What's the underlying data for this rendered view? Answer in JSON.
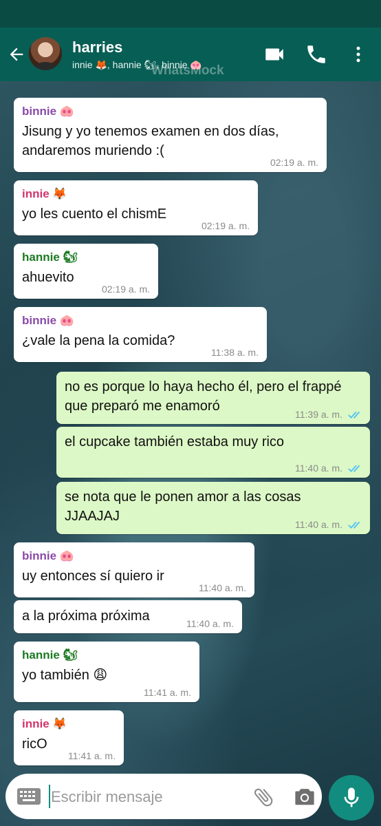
{
  "header": {
    "title": "harries",
    "subtitle": "innie 🦊, hannie 🐿, binnie 🐽",
    "watermark": "WhatsMock"
  },
  "messages": [
    {
      "sender": "binnie",
      "sender_label": "binnie 🐽",
      "text": "Jisung y yo tenemos examen en dos días, andaremos muriendo :(",
      "time": "02:19 a. m.",
      "direction": "in"
    },
    {
      "sender": "innie",
      "sender_label": "innie 🦊",
      "text": "yo les cuento el chismE",
      "time": "02:19 a. m.",
      "direction": "in"
    },
    {
      "sender": "hannie",
      "sender_label": "hannie 🐿",
      "text": "ahuevito",
      "time": "02:19 a. m.",
      "direction": "in"
    },
    {
      "sender": "binnie",
      "sender_label": "binnie 🐽",
      "text": "¿vale la pena la comida?",
      "time": "11:38 a. m.",
      "direction": "in"
    },
    {
      "sender": "me",
      "text": "no es porque lo haya hecho él, pero el frappé que preparó me enamoró",
      "time": "11:39 a. m.",
      "direction": "out"
    },
    {
      "sender": "me",
      "text": "el cupcake también estaba muy rico",
      "time": "11:40 a. m.",
      "direction": "out"
    },
    {
      "sender": "me",
      "text": "se nota que le ponen amor a las cosas JJAAJAJ",
      "time": "11:40 a. m.",
      "direction": "out"
    },
    {
      "sender": "binnie",
      "sender_label": "binnie 🐽",
      "text": "uy entonces sí quiero ir",
      "time": "11:40 a. m.",
      "direction": "in"
    },
    {
      "sender": "binnie",
      "text": "a la próxima próxima",
      "time": "11:40 a. m.",
      "direction": "in"
    },
    {
      "sender": "hannie",
      "sender_label": "hannie 🐿",
      "text": "yo también 😩",
      "time": "11:41 a. m.",
      "direction": "in"
    },
    {
      "sender": "innie",
      "sender_label": "innie 🦊",
      "text": "ricO",
      "time": "11:41 a. m.",
      "direction": "in"
    }
  ],
  "composer": {
    "placeholder": "Escribir mensaje"
  },
  "colors": {
    "header": "#075e54",
    "outgoing_bubble": "#dcf8c6",
    "incoming_bubble": "#ffffff",
    "fab": "#128c7e",
    "read_ticks": "#4fc3f7"
  }
}
